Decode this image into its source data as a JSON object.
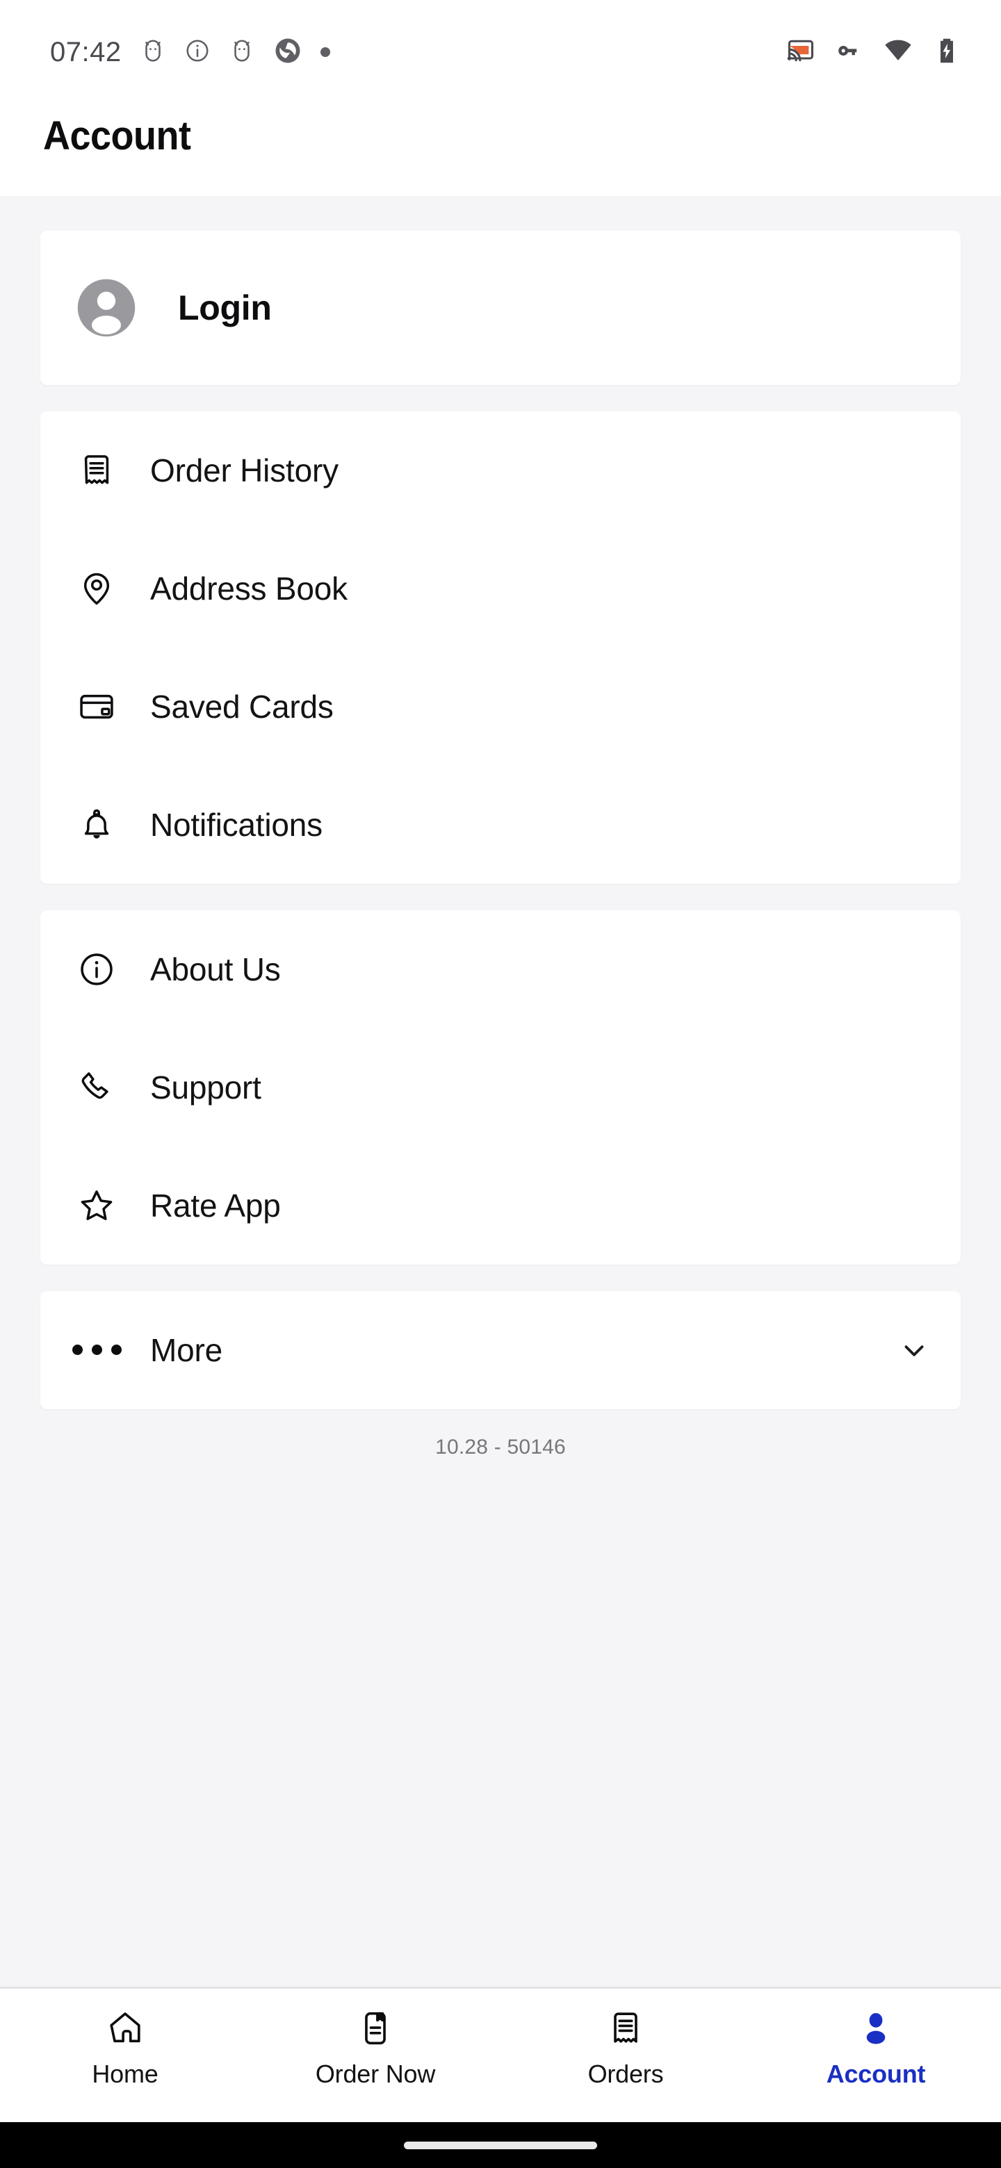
{
  "status_bar": {
    "time": "07:42",
    "left_icons": [
      "android-debug-icon",
      "info-circle-icon",
      "android-debug-icon",
      "shutter-logo-icon",
      "small-dot-icon"
    ],
    "right_icons": [
      "cast-icon",
      "vpn-key-icon",
      "wifi-icon",
      "battery-charging-icon"
    ],
    "cast_accent_color": "#e8653a"
  },
  "header": {
    "title": "Account"
  },
  "login_card": {
    "label": "Login",
    "avatar_icon": "account-circle-icon",
    "avatar_color": "#9a9a9e"
  },
  "account_menu": {
    "items": [
      {
        "label": "Order History",
        "icon": "receipt-icon"
      },
      {
        "label": "Address Book",
        "icon": "location-pin-icon"
      },
      {
        "label": "Saved Cards",
        "icon": "credit-card-icon"
      },
      {
        "label": "Notifications",
        "icon": "bell-icon"
      }
    ]
  },
  "info_menu": {
    "items": [
      {
        "label": "About Us",
        "icon": "info-circle-icon"
      },
      {
        "label": "Support",
        "icon": "phone-icon"
      },
      {
        "label": "Rate App",
        "icon": "star-icon"
      }
    ]
  },
  "more_row": {
    "label": "More",
    "icon": "ellipsis-icon",
    "chevron": "chevron-down-icon"
  },
  "version": "10.28 - 50146",
  "bottom_nav": {
    "active_color": "#1a2fc4",
    "items": [
      {
        "label": "Home",
        "icon": "home-icon",
        "active": false
      },
      {
        "label": "Order Now",
        "icon": "menu-book-icon",
        "active": false
      },
      {
        "label": "Orders",
        "icon": "receipt-icon",
        "active": false
      },
      {
        "label": "Account",
        "icon": "person-filled-icon",
        "active": true
      }
    ]
  }
}
